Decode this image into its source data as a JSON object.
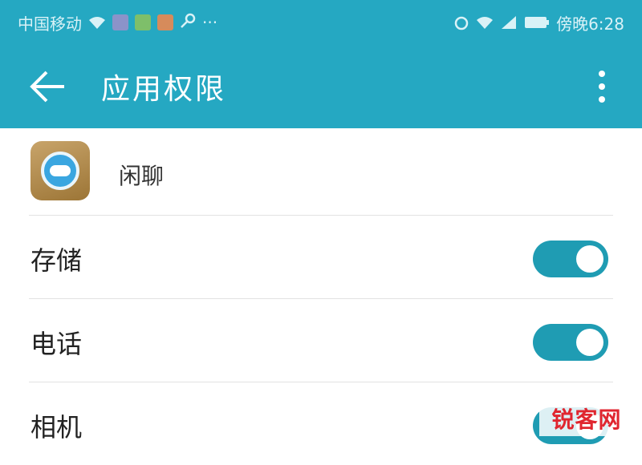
{
  "status_bar": {
    "carrier": "中国移动",
    "time": "傍晚6:28",
    "more": "···"
  },
  "app_bar": {
    "title": "应用权限"
  },
  "app": {
    "name": "闲聊"
  },
  "permissions": [
    {
      "label": "存储",
      "enabled": true
    },
    {
      "label": "电话",
      "enabled": true
    },
    {
      "label": "相机",
      "enabled": true
    }
  ],
  "watermark": "锐客网",
  "colors": {
    "accent": "#25a8c2",
    "toggle_on": "#1f9cb3",
    "watermark": "#e0262f"
  }
}
